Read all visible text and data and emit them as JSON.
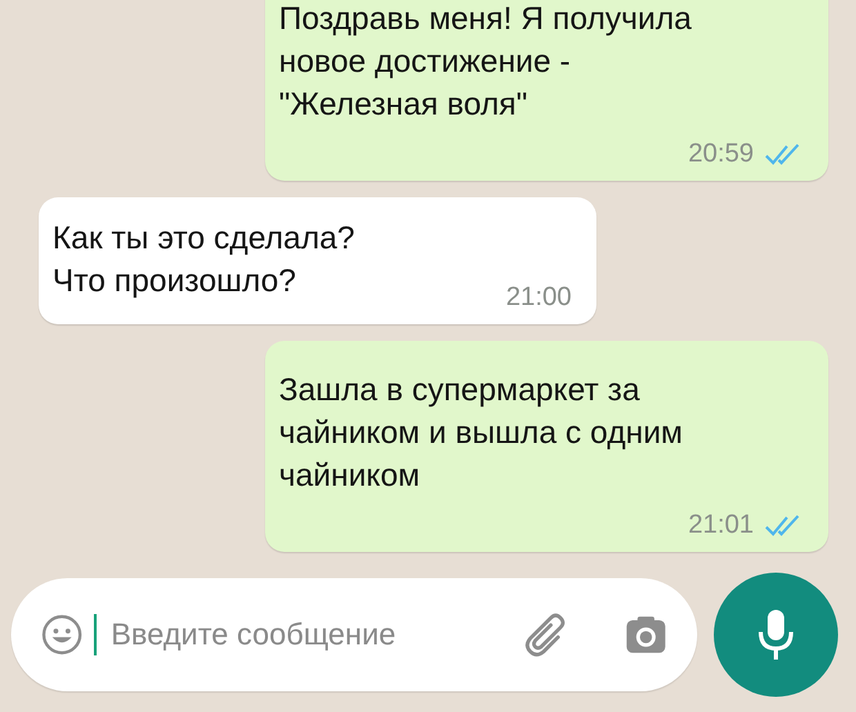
{
  "messages": [
    {
      "kind": "outgoing",
      "text": "Поздравь меня! Я получила\nновое достижение -\n\"Железная воля\"",
      "time": "20:59",
      "read": true
    },
    {
      "kind": "incoming",
      "text": "Как ты это сделала?\nЧто произошло?",
      "time": "21:00"
    },
    {
      "kind": "outgoing",
      "text": "Зашла в супермаркет за\nчайником и вышла с одним\nчайником",
      "time": "21:01",
      "read": true
    }
  ],
  "composer": {
    "placeholder": "Введите сообщение"
  }
}
